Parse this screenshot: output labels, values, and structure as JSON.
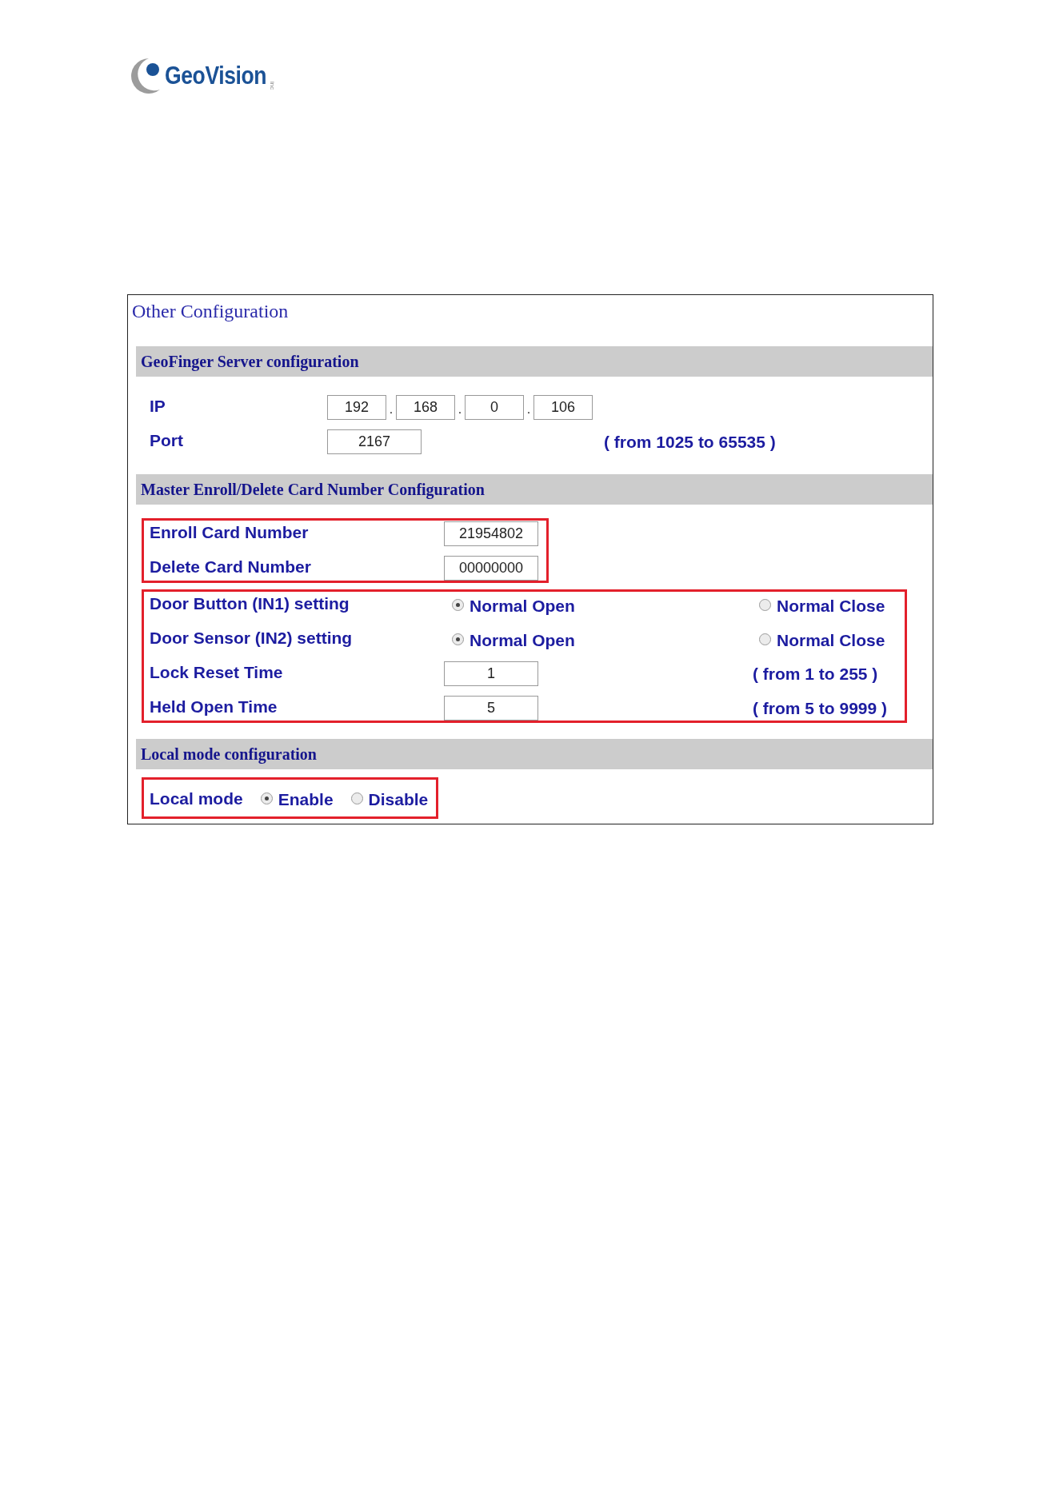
{
  "logo": {
    "wordmark": "GeoVision",
    "suffix": "inc"
  },
  "panel": {
    "title": "Other Configuration"
  },
  "sections": [
    {
      "title": "GeoFinger Server configuration",
      "groups": [
        {
          "highlighted": false,
          "rows": [
            {
              "kind": "ip",
              "label": "IP",
              "octets": [
                "192",
                "168",
                "0",
                "106"
              ],
              "separators": [
                ".",
                ".",
                "."
              ]
            },
            {
              "kind": "input",
              "label": "Port",
              "value": "2167",
              "hint": "( from 1025 to 65535 )"
            }
          ]
        }
      ]
    },
    {
      "title": "Master Enroll/Delete Card Number Configuration",
      "groups": [
        {
          "highlighted": true,
          "rows": [
            {
              "kind": "input",
              "label": "Enroll Card Number",
              "value": "21954802"
            },
            {
              "kind": "input",
              "label": "Delete Card Number",
              "value": "00000000"
            }
          ]
        },
        {
          "highlighted": true,
          "rows": [
            {
              "kind": "radio",
              "label": "Door Button (IN1) setting",
              "options": [
                {
                  "label": "Normal Open",
                  "selected": true
                },
                {
                  "label": "Normal Close",
                  "selected": false
                }
              ]
            },
            {
              "kind": "radio",
              "label": "Door Sensor (IN2) setting",
              "options": [
                {
                  "label": "Normal Open",
                  "selected": true
                },
                {
                  "label": "Normal Close",
                  "selected": false
                }
              ]
            },
            {
              "kind": "input",
              "label": "Lock Reset Time",
              "value": "1",
              "hint": "( from 1 to 255 )"
            },
            {
              "kind": "input",
              "label": "Held Open Time",
              "value": "5",
              "hint": "( from 5 to 9999 )"
            }
          ]
        }
      ]
    },
    {
      "title": "Local mode configuration",
      "groups": [
        {
          "highlighted": true,
          "rows": [
            {
              "kind": "radio-inline",
              "label": "Local mode",
              "options": [
                {
                  "label": "Enable",
                  "selected": true
                },
                {
                  "label": "Disable",
                  "selected": false
                }
              ]
            }
          ]
        }
      ]
    }
  ]
}
